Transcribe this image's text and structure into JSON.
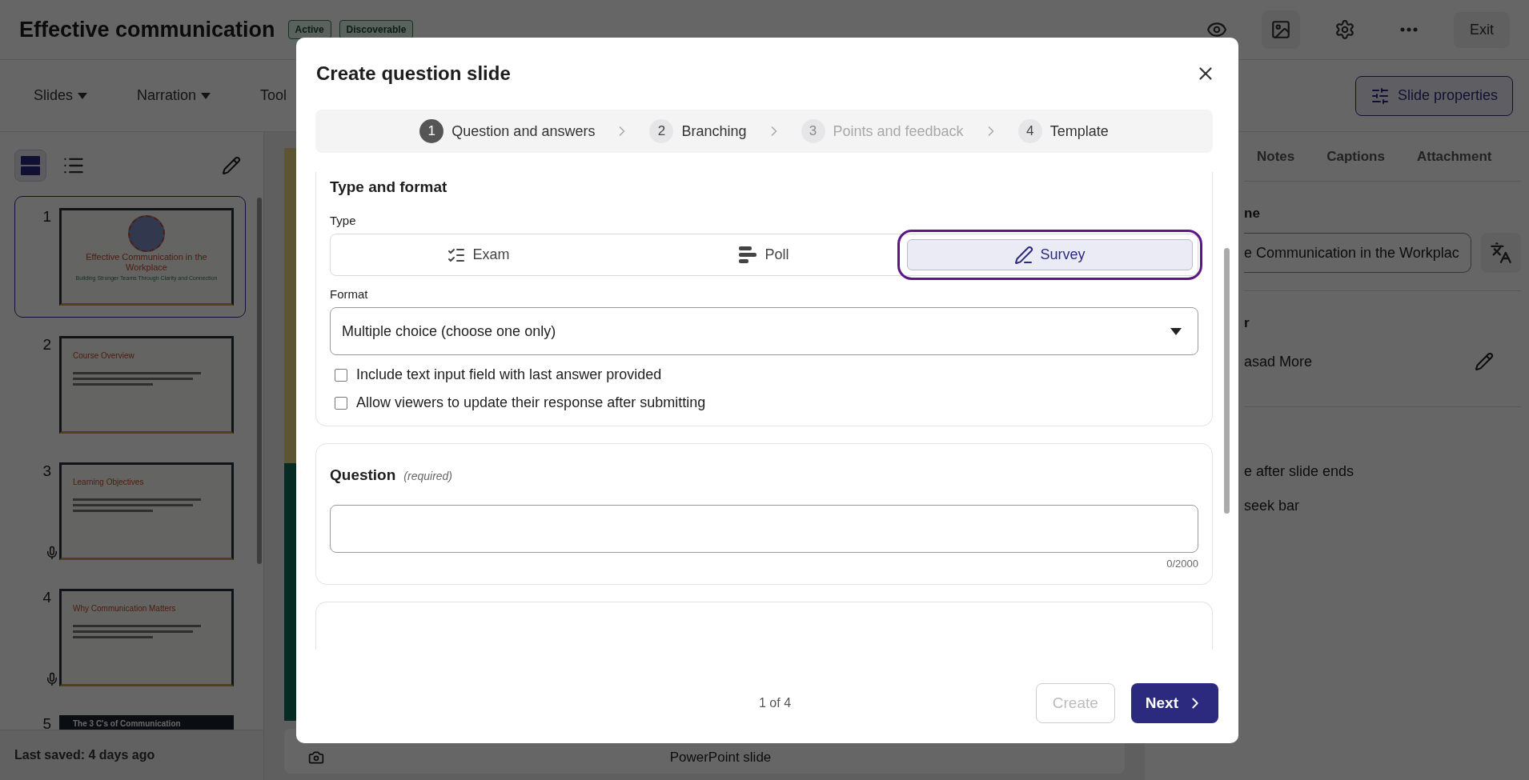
{
  "header": {
    "title": "Effective communication",
    "badges": [
      "Active",
      "Discoverable"
    ],
    "exit": "Exit"
  },
  "toolbar": {
    "menus": [
      {
        "label": "Slides",
        "caret": true
      },
      {
        "label": "Narration",
        "caret": true
      },
      {
        "label": "Tool",
        "caret": false
      }
    ],
    "properties_button": "Slide properties"
  },
  "sidebar": {
    "views": [
      {
        "kind": "thumbnails",
        "selected": true
      },
      {
        "kind": "list",
        "selected": false
      }
    ],
    "slides": [
      {
        "number": "1",
        "kind": "title",
        "title": "Effective Communication in the Workplace",
        "subtitle": "Building Stronger Teams Through Clarity and Connection",
        "selected": true,
        "narration": false
      },
      {
        "number": "2",
        "kind": "content",
        "title": "Course Overview",
        "selected": false,
        "narration": false
      },
      {
        "number": "3",
        "kind": "content",
        "title": "Learning Objectives",
        "selected": false,
        "narration": true
      },
      {
        "number": "4",
        "kind": "content",
        "title": "Why Communication Matters",
        "selected": false,
        "narration": true
      },
      {
        "number": "5",
        "kind": "dark",
        "title": "The 3 C's of Communication",
        "selected": false,
        "narration": false
      }
    ],
    "status": "Last saved: 4 days ago"
  },
  "canvas": {
    "caption": "PowerPoint slide"
  },
  "properties": {
    "tabs": [
      {
        "label": "Notes",
        "selected": false
      },
      {
        "label": "Captions",
        "selected": false
      },
      {
        "label": "Attachment",
        "selected": false
      }
    ],
    "name_label": "ne",
    "name_value": "e Communication in the Workplac",
    "author_label": "r",
    "author": "asad More",
    "options": [
      "e after slide ends",
      "seek bar"
    ]
  },
  "dialog": {
    "title": "Create question slide",
    "steps": [
      {
        "number": "1",
        "label": "Question and answers",
        "selected": true,
        "disabled": false
      },
      {
        "number": "2",
        "label": "Branching",
        "selected": false,
        "disabled": false
      },
      {
        "number": "3",
        "label": "Points and feedback",
        "selected": false,
        "disabled": true
      },
      {
        "number": "4",
        "label": "Template",
        "selected": false,
        "disabled": false
      }
    ],
    "type_section": {
      "heading": "Type and format",
      "type_label": "Type",
      "types": [
        {
          "kind": "exam",
          "label": "Exam",
          "selected": false
        },
        {
          "kind": "poll",
          "label": "Poll",
          "selected": false
        },
        {
          "kind": "survey",
          "label": "Survey",
          "selected": true
        }
      ],
      "format_label": "Format",
      "format_value": "Multiple choice (choose one only)",
      "options": [
        {
          "label": "Include text input field with last answer provided",
          "checked": false
        },
        {
          "label": "Allow viewers to update their response after submitting",
          "checked": false
        }
      ]
    },
    "question_section": {
      "heading": "Question",
      "hint": "(required)",
      "counter": "0/2000"
    },
    "footer": {
      "page": "1 of 4",
      "buttons": [
        {
          "label": "Create",
          "disabled": true,
          "kind": "outline"
        },
        {
          "label": "Next",
          "disabled": false,
          "kind": "primary"
        }
      ]
    }
  }
}
